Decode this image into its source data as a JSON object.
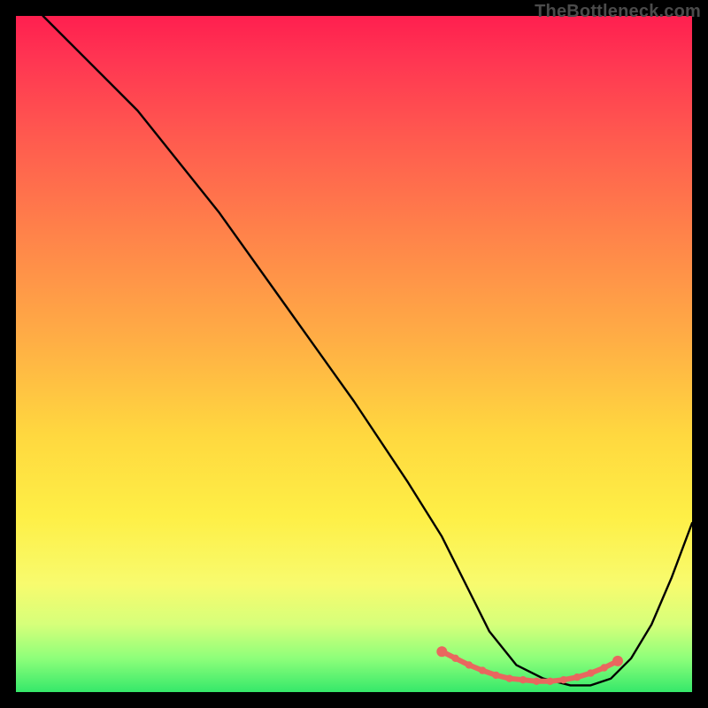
{
  "watermark": "TheBottleneck.com",
  "chart_data": {
    "type": "line",
    "title": "",
    "xlabel": "",
    "ylabel": "",
    "xlim": [
      0,
      100
    ],
    "ylim": [
      0,
      100
    ],
    "series": [
      {
        "name": "bottleneck-curve",
        "x": [
          4,
          10,
          18,
          30,
          40,
          50,
          58,
          63,
          67,
          70,
          74,
          78,
          82,
          85,
          88,
          91,
          94,
          97,
          100
        ],
        "y": [
          100,
          94,
          86,
          71,
          57,
          43,
          31,
          23,
          15,
          9,
          4,
          2,
          1,
          1,
          2,
          5,
          10,
          17,
          25
        ]
      }
    ],
    "highlight_region": {
      "name": "optimal-range-dots",
      "x": [
        63,
        65,
        67,
        69,
        71,
        73,
        75,
        77,
        79,
        81,
        83,
        85,
        87,
        89
      ],
      "y": [
        6,
        5,
        4,
        3.2,
        2.5,
        2,
        1.8,
        1.6,
        1.6,
        1.8,
        2.2,
        2.8,
        3.6,
        4.6
      ]
    },
    "background_gradient": {
      "stops": [
        {
          "pos": 0.0,
          "color": "#ff1f4f"
        },
        {
          "pos": 0.06,
          "color": "#ff3452"
        },
        {
          "pos": 0.18,
          "color": "#ff5a4f"
        },
        {
          "pos": 0.32,
          "color": "#ff824a"
        },
        {
          "pos": 0.48,
          "color": "#ffae45"
        },
        {
          "pos": 0.62,
          "color": "#ffd83f"
        },
        {
          "pos": 0.74,
          "color": "#feef46"
        },
        {
          "pos": 0.84,
          "color": "#f8fb6e"
        },
        {
          "pos": 0.9,
          "color": "#d6ff7a"
        },
        {
          "pos": 0.95,
          "color": "#8eff7a"
        },
        {
          "pos": 1.0,
          "color": "#35e86a"
        }
      ]
    }
  }
}
